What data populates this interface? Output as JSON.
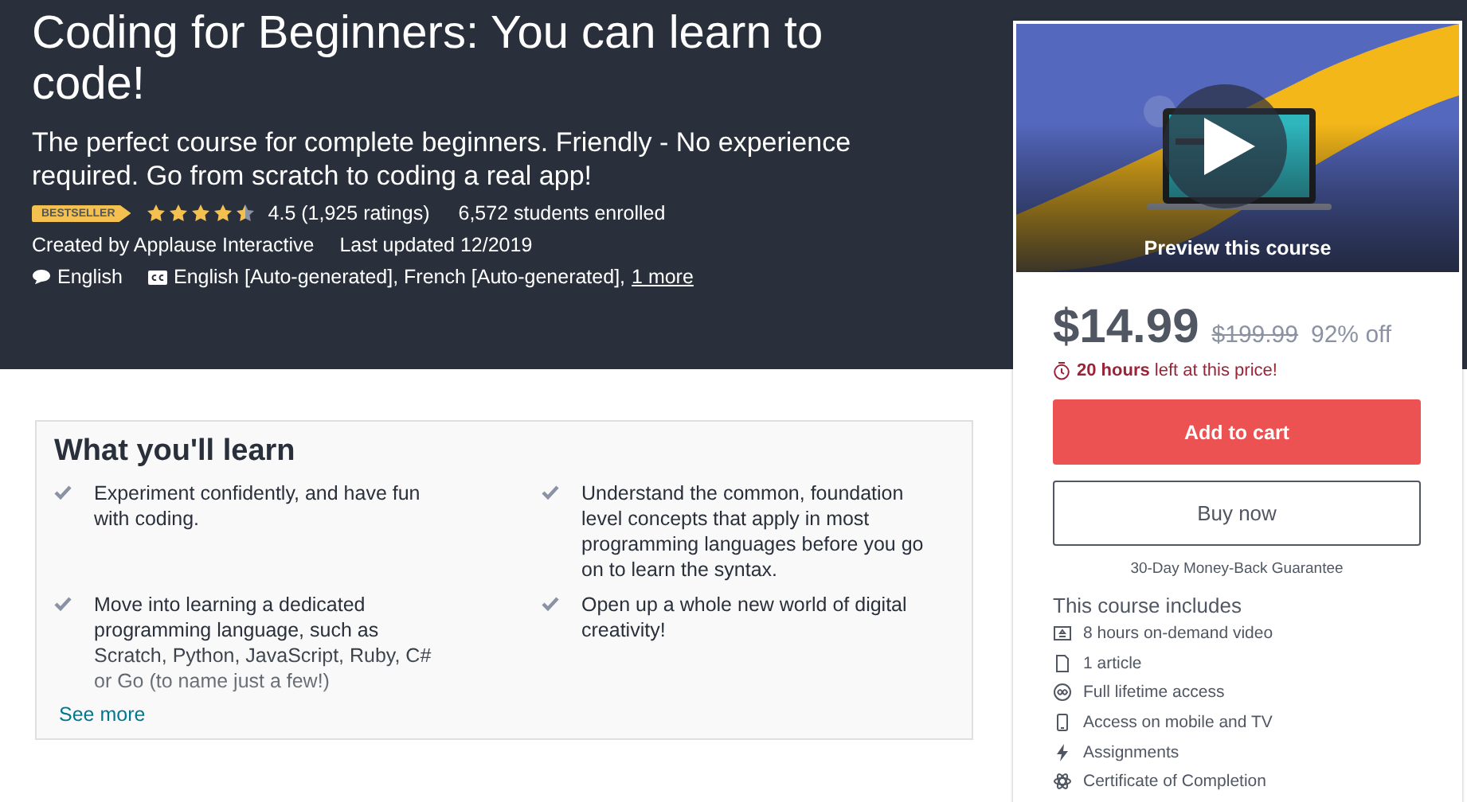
{
  "header": {
    "title": "Coding for Beginners: You can learn to code!",
    "subtitle": "The perfect course for complete beginners. Friendly - No experience required. Go from scratch to coding a real app!",
    "badge": "BESTSELLER",
    "stars": 4.5,
    "rating": "4.5 (1,925 ratings)",
    "students": "6,572 students enrolled",
    "created_by": "Created by Applause Interactive",
    "last_updated": "Last updated 12/2019",
    "language": "English",
    "captions": "English [Auto-generated], French [Auto-generated],",
    "captions_more": "1 more"
  },
  "learn": {
    "title": "What you'll learn",
    "items": [
      {
        "text": "Experiment confidently, and have fun with coding."
      },
      {
        "text": "Understand the common, foundation level concepts that apply in most programming languages before you go on to learn the syntax."
      },
      {
        "text": "Move into learning a dedicated programming language, such as Scratch, Python, JavaScript, Ruby, C# or Go (to name just a few!)"
      },
      {
        "text": "Open up a whole new world of digital creativity!"
      }
    ],
    "see_more": "See more"
  },
  "card": {
    "preview_label": "Preview this course",
    "price": "$14.99",
    "original_price": "$199.99",
    "discount": "92% off",
    "timer_bold": "20 hours",
    "timer_rest": "left at this price!",
    "add_to_cart": "Add to cart",
    "buy_now": "Buy now",
    "guarantee": "30-Day Money-Back Guarantee",
    "includes_title": "This course includes",
    "includes": [
      {
        "kind": "video",
        "text": "8 hours on-demand video"
      },
      {
        "kind": "article",
        "text": "1 article"
      },
      {
        "kind": "lifetime",
        "text": "Full lifetime access"
      },
      {
        "kind": "mobile",
        "text": "Access on mobile and TV"
      },
      {
        "kind": "assignments",
        "text": "Assignments"
      },
      {
        "kind": "certificate",
        "text": "Certificate of Completion"
      }
    ]
  }
}
